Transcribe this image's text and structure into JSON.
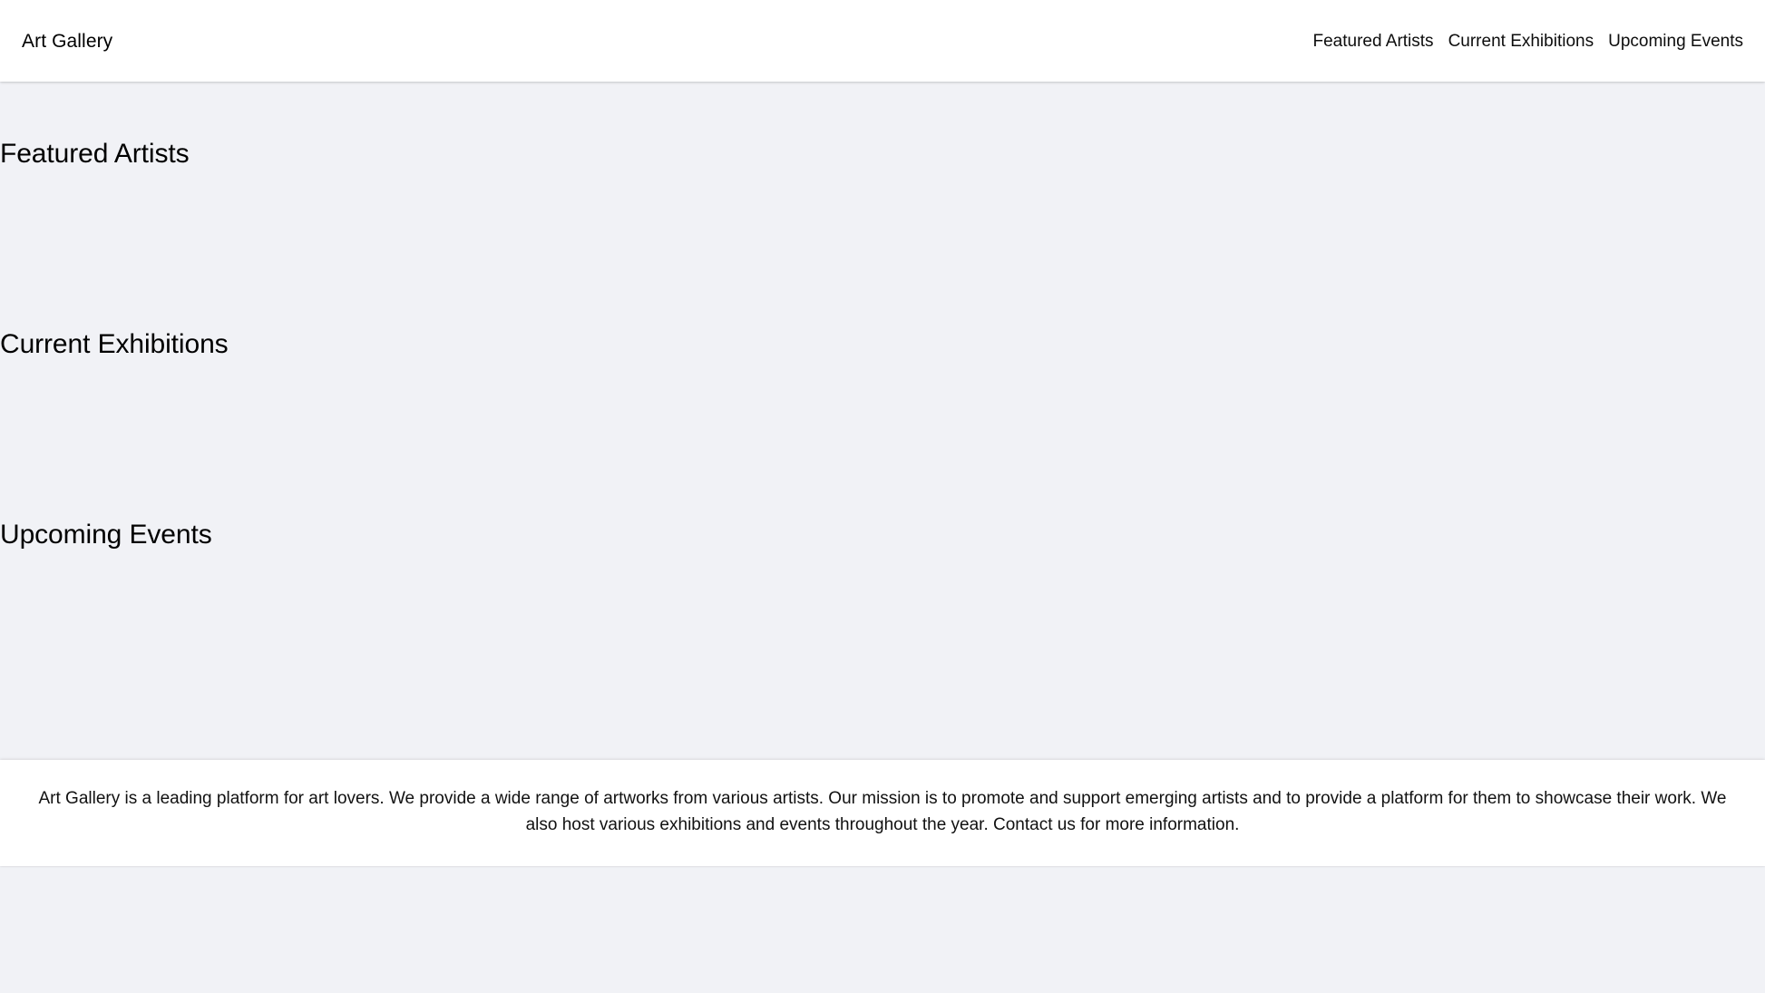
{
  "site": {
    "brand": "Art Gallery",
    "background_color": "#f1f2f6",
    "surface_color": "#ffffff",
    "text_color": "#000000"
  },
  "header": {
    "nav": [
      {
        "label": "Featured Artists"
      },
      {
        "label": "Current Exhibitions"
      },
      {
        "label": "Upcoming Events"
      }
    ]
  },
  "main": {
    "sections": [
      {
        "heading": "Featured Artists"
      },
      {
        "heading": "Current Exhibitions"
      },
      {
        "heading": "Upcoming Events"
      }
    ]
  },
  "footer": {
    "about": "Art Gallery is a leading platform for art lovers. We provide a wide range of artworks from various artists. Our mission is to promote and support emerging artists and to provide a platform for them to showcase their work. We also host various exhibitions and events throughout the year. Contact us for more information."
  }
}
